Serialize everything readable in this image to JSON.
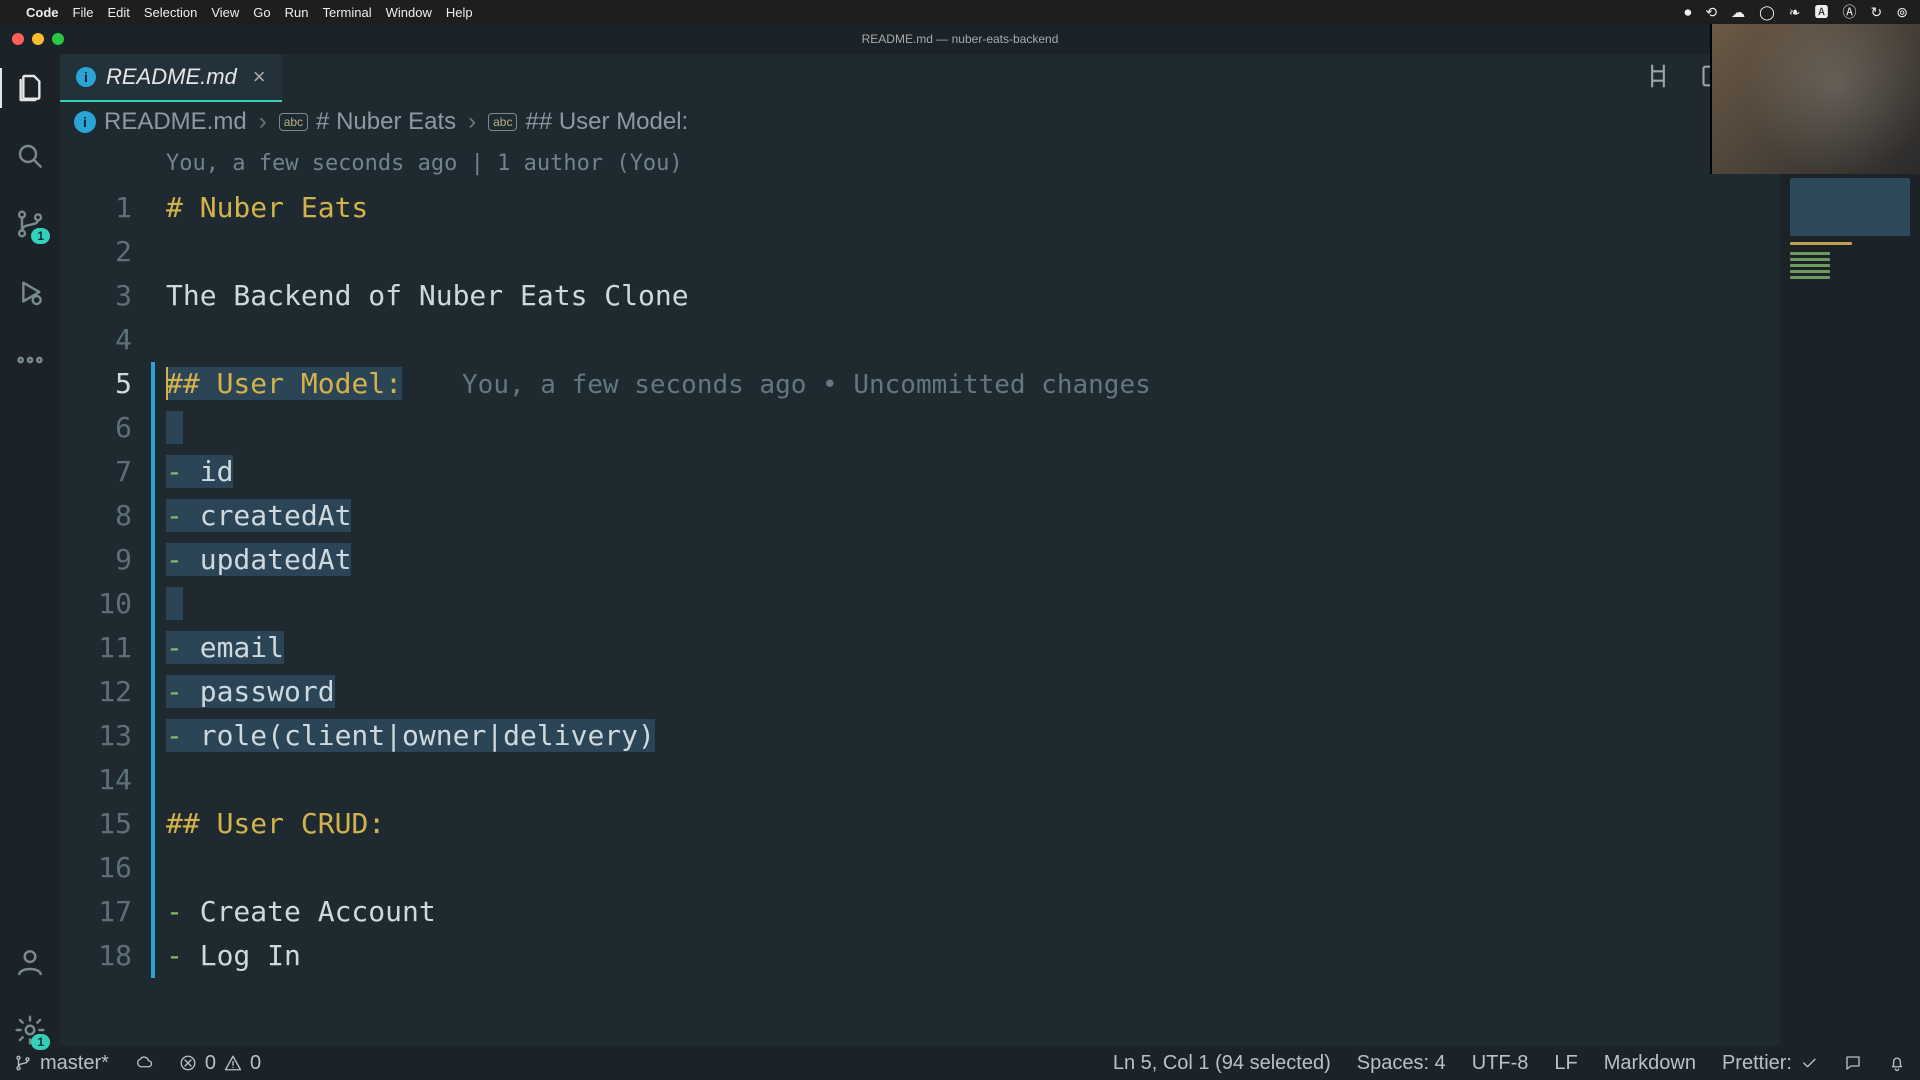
{
  "mac_menu": {
    "app": "Code",
    "items": [
      "File",
      "Edit",
      "Selection",
      "View",
      "Go",
      "Run",
      "Terminal",
      "Window",
      "Help"
    ]
  },
  "window": {
    "title": "README.md — nuber-eats-backend"
  },
  "tab": {
    "filename": "README.md"
  },
  "breadcrumb": {
    "file": "README.md",
    "h1": "# Nuber Eats",
    "h2": "## User Model:"
  },
  "codelens": "You, a few seconds ago | 1 author (You)",
  "blame": "You, a few seconds ago • Uncommitted changes",
  "lines": {
    "l1_hash": "# ",
    "l1_txt": "Nuber Eats",
    "l3": "The Backend of Nuber Eats Clone",
    "l5_hash": "## ",
    "l5_txt": "User Model:",
    "l7_dash": "- ",
    "l7_txt": "id",
    "l8_dash": "- ",
    "l8_txt": "createdAt",
    "l9_dash": "- ",
    "l9_txt": "updatedAt",
    "l11_dash": "- ",
    "l11_txt": "email",
    "l12_dash": "- ",
    "l12_txt": "password",
    "l13_dash": "- ",
    "l13_txt": "role(client|owner|delivery)",
    "l15_hash": "## ",
    "l15_txt": "User CRUD:",
    "l17_dash": "- ",
    "l17_txt": "Create Account",
    "l18_dash": "- ",
    "l18_txt": "Log In"
  },
  "line_numbers": [
    "1",
    "2",
    "3",
    "4",
    "5",
    "6",
    "7",
    "8",
    "9",
    "10",
    "11",
    "12",
    "13",
    "14",
    "15",
    "16",
    "17",
    "18"
  ],
  "scm_badge": "1",
  "settings_badge": "1",
  "status": {
    "branch": "master*",
    "errors": "0",
    "warnings": "0",
    "cursor": "Ln 5, Col 1 (94 selected)",
    "spaces": "Spaces: 4",
    "encoding": "UTF-8",
    "eol": "LF",
    "lang": "Markdown",
    "prettier": "Prettier: "
  }
}
